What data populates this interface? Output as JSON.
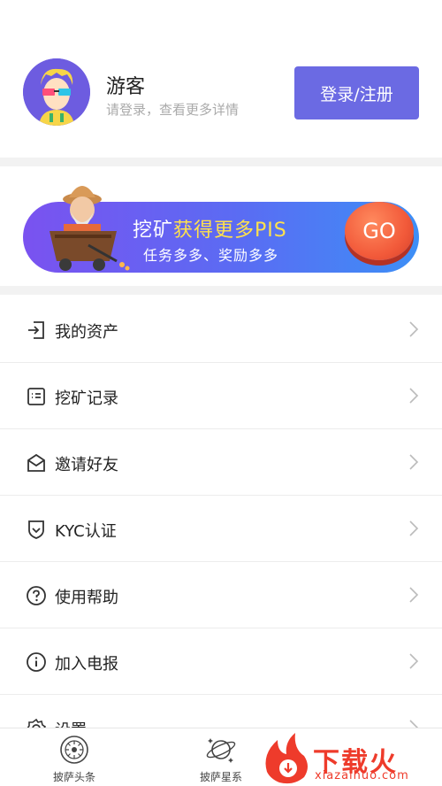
{
  "profile": {
    "name": "游客",
    "hint": "请登录，查看更多详情",
    "login_label": "登录/注册"
  },
  "banner": {
    "title_a": "挖矿",
    "title_b": "获得更多PIS",
    "subtitle": "任务多多、奖励多多",
    "go_label": "GO"
  },
  "menu": [
    {
      "label": "我的资产",
      "icon": "logout-arrow-icon"
    },
    {
      "label": "挖矿记录",
      "icon": "list-icon"
    },
    {
      "label": "邀请好友",
      "icon": "envelope-icon"
    },
    {
      "label": "KYC认证",
      "icon": "shield-check-icon"
    },
    {
      "label": "使用帮助",
      "icon": "help-circle-icon"
    },
    {
      "label": "加入电报",
      "icon": "info-circle-icon"
    },
    {
      "label": "设置",
      "icon": "gear-icon"
    }
  ],
  "tabs": [
    {
      "label": "披萨头条",
      "icon": "news-icon"
    },
    {
      "label": "披萨星系",
      "icon": "planet-icon"
    }
  ],
  "watermark": {
    "text": "下载火",
    "url": "xiazaihuo.com"
  },
  "colors": {
    "accent": "#6b6ae3",
    "banner_start": "#7a52f0",
    "banner_end": "#3d8ff6",
    "go": "#f25a3a",
    "highlight": "#ffe14d",
    "watermark": "#ee3b2b"
  }
}
